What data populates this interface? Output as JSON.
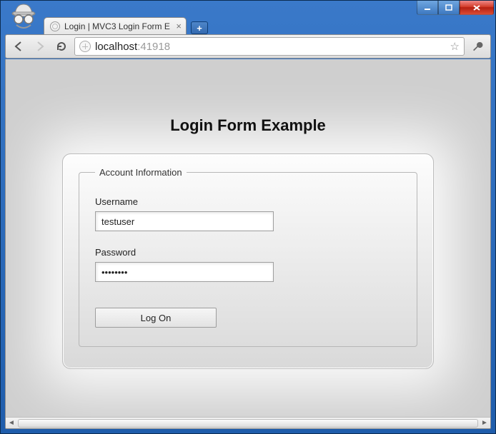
{
  "window": {
    "controls": {
      "minimize": "minimize",
      "maximize": "maximize",
      "close": "close"
    }
  },
  "browser": {
    "incognito": true,
    "tab": {
      "title": "Login | MVC3 Login Form E",
      "favicon": "globe-icon"
    },
    "new_tab_label": "+",
    "nav": {
      "back": "back",
      "forward": "forward",
      "reload": "reload"
    },
    "omnibox": {
      "scheme_icon": "globe-icon",
      "host": "localhost",
      "port": ":41918",
      "star": "bookmark-star",
      "wrench": "settings-wrench"
    }
  },
  "page": {
    "heading": "Login Form Example",
    "fieldset_legend": "Account Information",
    "username": {
      "label": "Username",
      "value": "testuser"
    },
    "password": {
      "label": "Password",
      "value": "••••••••"
    },
    "submit_label": "Log On"
  },
  "scrollbar": {
    "left_arrow": "◄",
    "right_arrow": "►"
  }
}
